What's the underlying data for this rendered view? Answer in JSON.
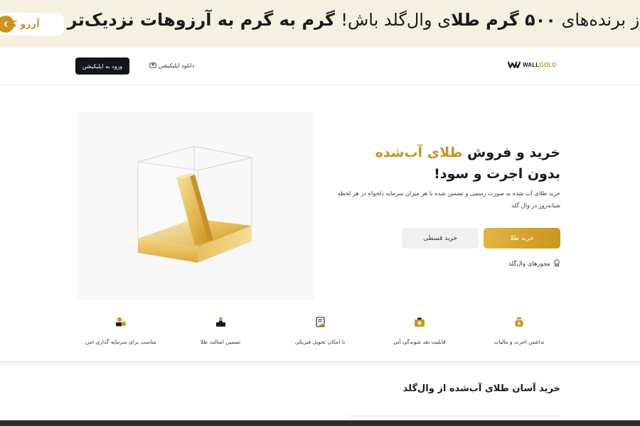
{
  "promo": {
    "text_part1": "از برنده‌های ",
    "text_bold1": "۵۰۰ گرم طلا",
    "text_part2": "ی وال‌گلد باش!",
    "text_bold2": "  گرم به گرم به آرزوهات نزدیک‌تر شو",
    "button_label": "آرزو کـن",
    "background": "#f6f0e1",
    "accent": "#c9951d"
  },
  "header": {
    "logo_word1": "WALL",
    "logo_word2": "GOLD",
    "download_label": "دانلود اپلیکیشن",
    "login_label": "ورود به اپلیکیشن"
  },
  "hero": {
    "title_line1_prefix": "خرید و فروش ",
    "title_line1_gold": "طلای آب‌شده",
    "title_line2": "بدون اجرت و سود!",
    "description": "خرید طلای آب شده به صورت رسمی و تضمین شده با هر میزان سرمایه دلخواه در هر لحظه شبانه‌روز در وال گلد",
    "buy_button": "خرید طلا",
    "installment_button": "خرید قسطی",
    "licenses_link": "مجوزهای وال‌گلد"
  },
  "features": [
    {
      "label": "نداشتن اجرت و مالیات",
      "icon": "gold-pot-icon"
    },
    {
      "label": "قابلیت نقد شوندگی آنی",
      "icon": "cash-coin-icon"
    },
    {
      "label": "با امکان تحویل فیزیکی",
      "icon": "delivery-note-icon"
    },
    {
      "label": "تضمین اصالت طلا",
      "icon": "podium-gold-icon"
    },
    {
      "label": "مناسب برای سرمایه گذاری امن",
      "icon": "coins-stack-icon"
    }
  ],
  "section": {
    "title": "خرید آسان طلای آب‌شده از وال‌گلد"
  },
  "colors": {
    "gold": "#c9951d",
    "dark": "#13161c"
  }
}
